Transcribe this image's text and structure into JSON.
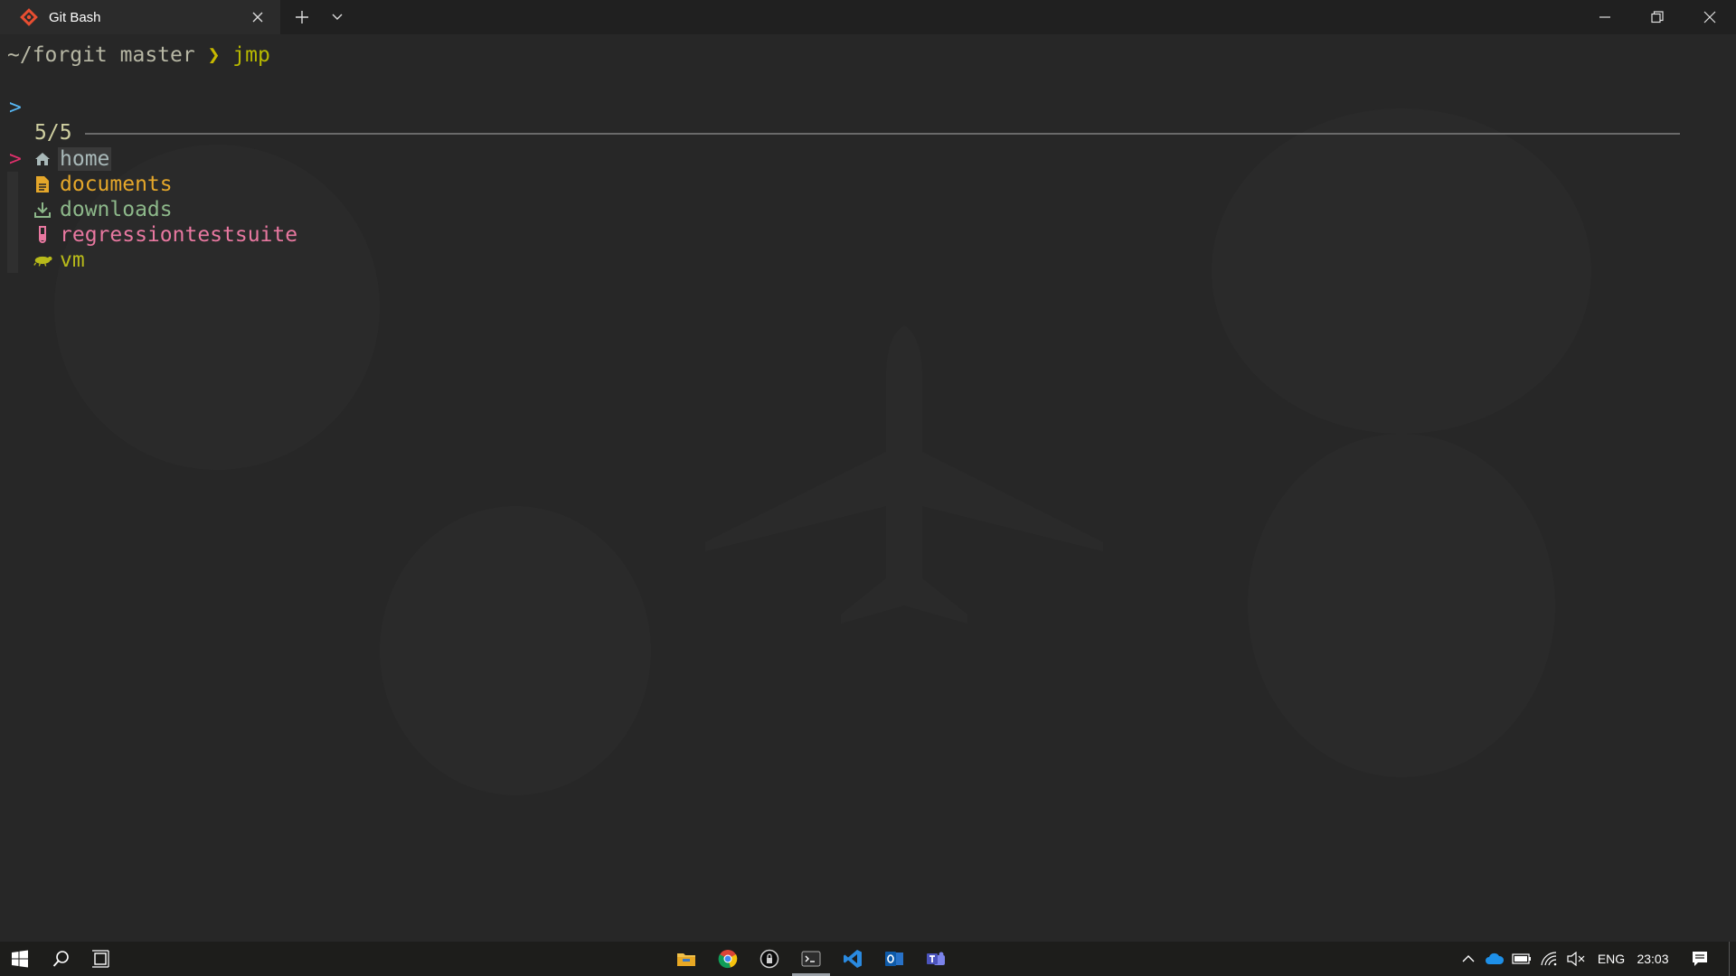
{
  "window": {
    "tab_title": "Git Bash",
    "icons": {
      "app": "git-bash-icon",
      "close_tab": "close-icon",
      "new_tab": "plus-icon",
      "dropdown": "chevron-down-icon",
      "minimize": "minimize-icon",
      "maximize": "restore-icon",
      "close": "close-icon"
    }
  },
  "terminal": {
    "prompt_path": "~/forgit master",
    "prompt_arrow": "❯",
    "command": "jmp",
    "fzf_prompt": ">",
    "count": "5/5",
    "pointer": ">",
    "items": [
      {
        "label": "home",
        "icon": "home-icon",
        "color": "#a9b9b9",
        "selected": true
      },
      {
        "label": "documents",
        "icon": "document-icon",
        "color": "#e5a72a",
        "selected": false
      },
      {
        "label": "downloads",
        "icon": "download-icon",
        "color": "#8db88a",
        "selected": false
      },
      {
        "label": "regressiontestsuite",
        "icon": "test-tube-icon",
        "color": "#e878a0",
        "selected": false
      },
      {
        "label": "vm",
        "icon": "lizard-icon",
        "color": "#b8ba1a",
        "selected": false
      }
    ]
  },
  "taskbar": {
    "apps": [
      "file-explorer-icon",
      "chrome-icon",
      "password-manager-icon",
      "terminal-icon",
      "vscode-icon",
      "outlook-icon",
      "teams-icon"
    ],
    "active_app": "terminal-icon",
    "language": "ENG",
    "time": "23:03"
  }
}
